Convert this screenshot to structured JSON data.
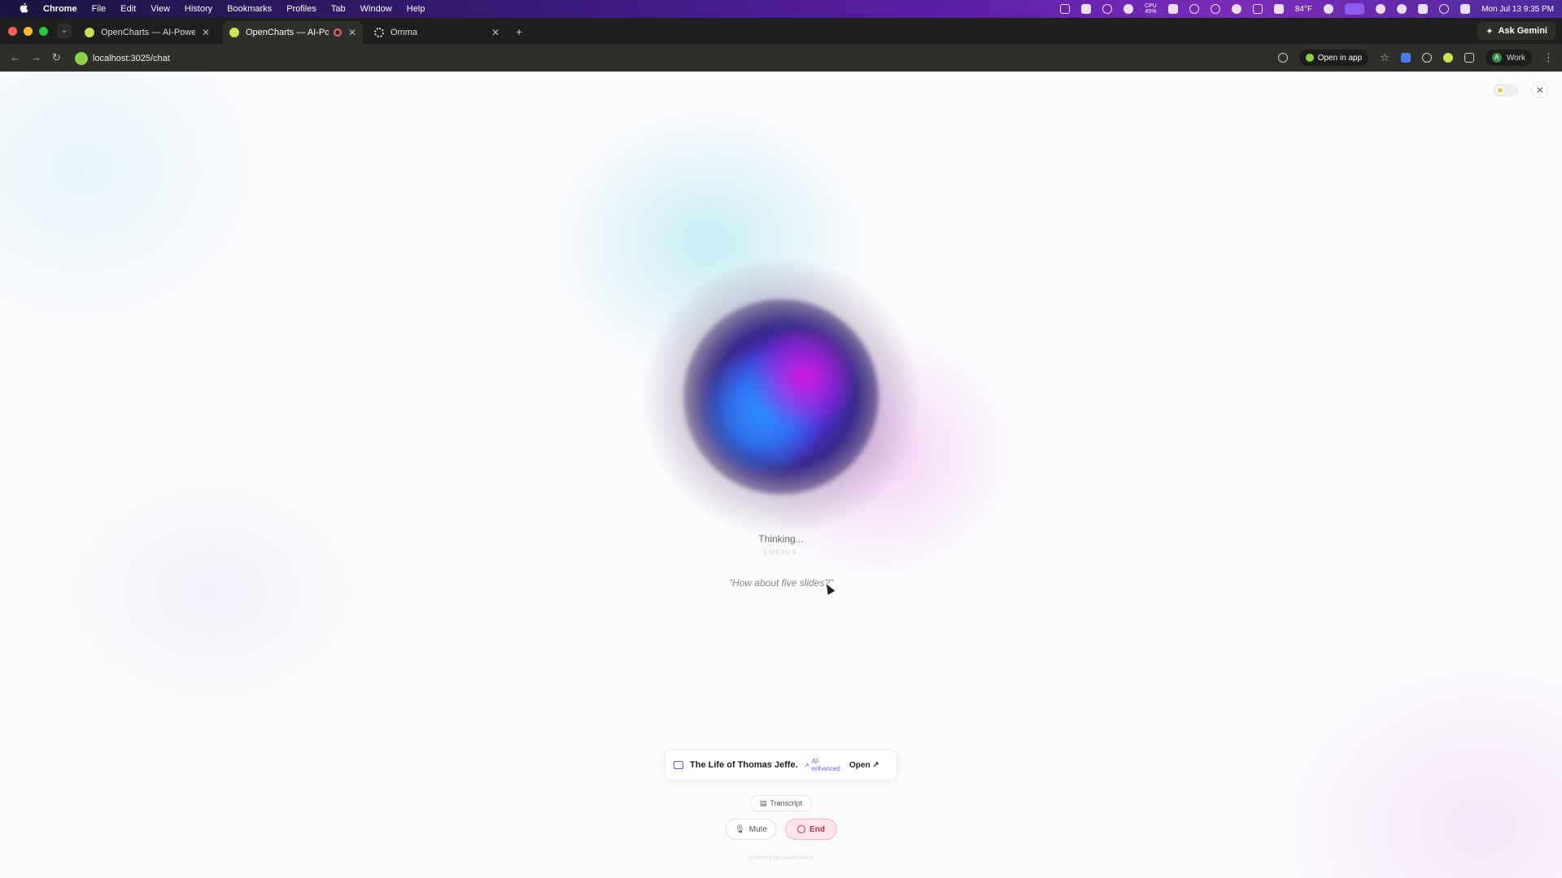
{
  "menubar": {
    "app": "Chrome",
    "items": [
      "File",
      "Edit",
      "View",
      "History",
      "Bookmarks",
      "Profiles",
      "Tab",
      "Window",
      "Help"
    ],
    "cpu_label": "CPU",
    "cpu_value": "45%",
    "weather": "84°F",
    "clock": "Mon Jul 13  9:35 PM"
  },
  "tabs": [
    {
      "title": "OpenCharts — AI-Powered P",
      "active": false
    },
    {
      "title": "OpenCharts — AI-Powere",
      "active": true
    },
    {
      "title": "Omma",
      "active": false
    }
  ],
  "gemini_label": "Ask Gemini",
  "toolbar": {
    "url": "localhost:3025/chat",
    "open_in_app": "Open in app",
    "profile_initial": "A",
    "profile": "Work"
  },
  "voice": {
    "status": "Thinking...",
    "agent": "LUCIUS",
    "quote": "“How about five slides?”"
  },
  "deck": {
    "title": "The Life of Thomas Jeffe...",
    "badge_line1": "AI-",
    "badge_line2": "enhanced",
    "open_label": "Open"
  },
  "controls": {
    "transcript": "Transcript",
    "mute": "Mute",
    "end": "End"
  },
  "footer": {
    "powered": "Powered by Lucius Voice"
  },
  "colors": {
    "accent_purple": "#7a5ae0",
    "end_red": "#c2335a",
    "orb_magenta": "#d21be0",
    "orb_blue": "#2a8cff"
  }
}
